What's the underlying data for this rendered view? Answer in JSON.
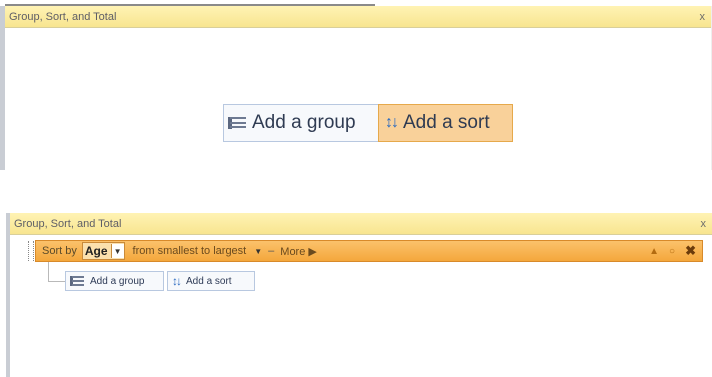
{
  "pane_top": {
    "title": "Group, Sort, and Total",
    "close_glyph": "x",
    "add_group_label": "Add a group",
    "add_sort_label": "Add a sort"
  },
  "pane_bottom": {
    "title": "Group, Sort, and Total",
    "close_glyph": "x",
    "sort_row": {
      "prefix": "Sort by",
      "field": "Age",
      "order": "from smallest to largest",
      "separator": "–",
      "more": "More ▶",
      "controls": [
        "▲",
        "○",
        "✖"
      ]
    },
    "add_group_label": "Add a group",
    "add_sort_label": "Add a sort"
  },
  "colors": {
    "title_bar": "#f8e590",
    "sort_row": "#f4a73c",
    "sort_highlight": "#f9d19a",
    "button_border": "#b8c8e0"
  }
}
